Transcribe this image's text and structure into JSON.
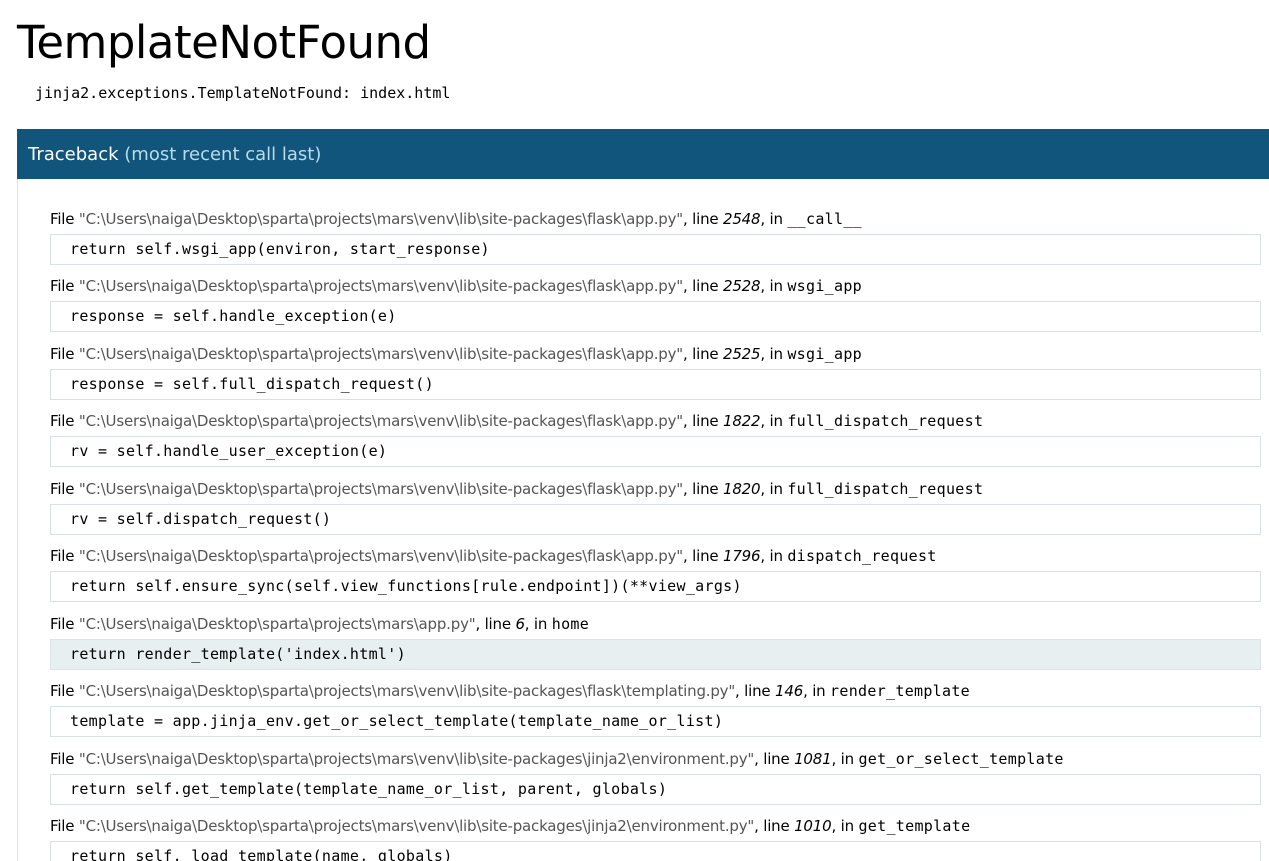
{
  "title": "TemplateNotFound",
  "error_message": "jinja2.exceptions.TemplateNotFound: index.html",
  "traceback": {
    "heading": "Traceback",
    "subheading": "(most recent call last)",
    "frames": [
      {
        "file_prefix": "File ",
        "path": "\"C:\\Users\\naiga\\Desktop\\sparta\\projects\\mars\\venv\\lib\\site-packages\\flask\\app.py\"",
        "line_label": ", line ",
        "line_no": "2548",
        "in_label": ", in ",
        "func": "__call__",
        "code": "return self.wsgi_app(environ, start_response)",
        "current": false
      },
      {
        "file_prefix": "File ",
        "path": "\"C:\\Users\\naiga\\Desktop\\sparta\\projects\\mars\\venv\\lib\\site-packages\\flask\\app.py\"",
        "line_label": ", line ",
        "line_no": "2528",
        "in_label": ", in ",
        "func": "wsgi_app",
        "code": "response = self.handle_exception(e)",
        "current": false
      },
      {
        "file_prefix": "File ",
        "path": "\"C:\\Users\\naiga\\Desktop\\sparta\\projects\\mars\\venv\\lib\\site-packages\\flask\\app.py\"",
        "line_label": ", line ",
        "line_no": "2525",
        "in_label": ", in ",
        "func": "wsgi_app",
        "code": "response = self.full_dispatch_request()",
        "current": false
      },
      {
        "file_prefix": "File ",
        "path": "\"C:\\Users\\naiga\\Desktop\\sparta\\projects\\mars\\venv\\lib\\site-packages\\flask\\app.py\"",
        "line_label": ", line ",
        "line_no": "1822",
        "in_label": ", in ",
        "func": "full_dispatch_request",
        "code": "rv = self.handle_user_exception(e)",
        "current": false
      },
      {
        "file_prefix": "File ",
        "path": "\"C:\\Users\\naiga\\Desktop\\sparta\\projects\\mars\\venv\\lib\\site-packages\\flask\\app.py\"",
        "line_label": ", line ",
        "line_no": "1820",
        "in_label": ", in ",
        "func": "full_dispatch_request",
        "code": "rv = self.dispatch_request()",
        "current": false
      },
      {
        "file_prefix": "File ",
        "path": "\"C:\\Users\\naiga\\Desktop\\sparta\\projects\\mars\\venv\\lib\\site-packages\\flask\\app.py\"",
        "line_label": ", line ",
        "line_no": "1796",
        "in_label": ", in ",
        "func": "dispatch_request",
        "code": "return self.ensure_sync(self.view_functions[rule.endpoint])(**view_args)",
        "current": false
      },
      {
        "file_prefix": "File ",
        "path": "\"C:\\Users\\naiga\\Desktop\\sparta\\projects\\mars\\app.py\"",
        "line_label": ", line ",
        "line_no": "6",
        "in_label": ", in ",
        "func": "home",
        "code": "return render_template('index.html')",
        "current": true
      },
      {
        "file_prefix": "File ",
        "path": "\"C:\\Users\\naiga\\Desktop\\sparta\\projects\\mars\\venv\\lib\\site-packages\\flask\\templating.py\"",
        "line_label": ", line ",
        "line_no": "146",
        "in_label": ", in ",
        "func": "render_template",
        "code": "template = app.jinja_env.get_or_select_template(template_name_or_list)",
        "current": false
      },
      {
        "file_prefix": "File ",
        "path": "\"C:\\Users\\naiga\\Desktop\\sparta\\projects\\mars\\venv\\lib\\site-packages\\jinja2\\environment.py\"",
        "line_label": ", line ",
        "line_no": "1081",
        "in_label": ", in ",
        "func": "get_or_select_template",
        "code": "return self.get_template(template_name_or_list, parent, globals)",
        "current": false
      },
      {
        "file_prefix": "File ",
        "path": "\"C:\\Users\\naiga\\Desktop\\sparta\\projects\\mars\\venv\\lib\\site-packages\\jinja2\\environment.py\"",
        "line_label": ", line ",
        "line_no": "1010",
        "in_label": ", in ",
        "func": "get_template",
        "code": "return self._load_template(name, globals)",
        "current": false
      }
    ]
  },
  "colors": {
    "header_bg": "#11557c",
    "header_text": "#ffffff",
    "header_subtext": "#b8dcea",
    "path_text": "#555555",
    "code_border": "#d7e2e7",
    "current_code_bg": "#e8eff0"
  }
}
